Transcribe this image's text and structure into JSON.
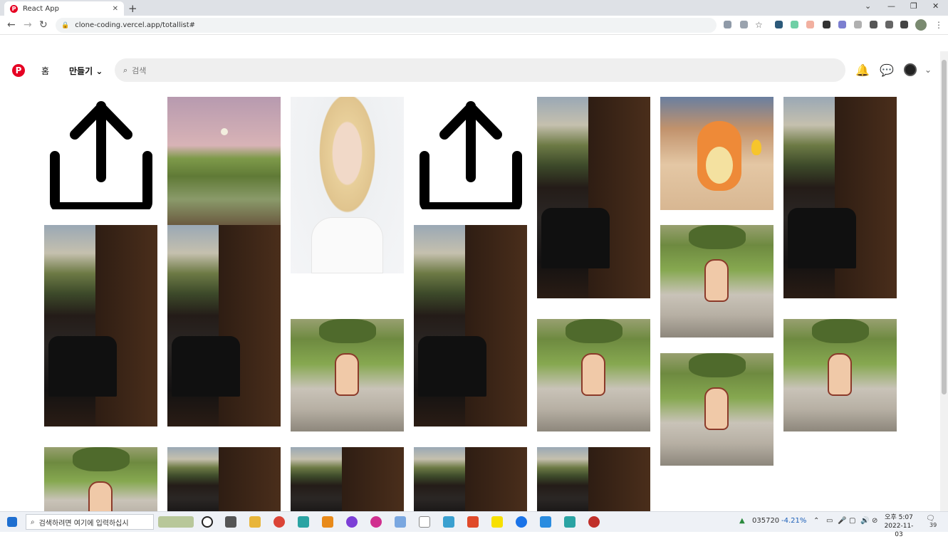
{
  "browser": {
    "tab_title": "React App",
    "tab_close": "✕",
    "new_tab": "+",
    "url": "clone-coding.vercel.app/totallist#"
  },
  "header": {
    "logo": "P",
    "home": "홈",
    "create": "만들기",
    "create_chevron": "⌄",
    "search_placeholder": "검색"
  },
  "pins": [
    {
      "type": "upload"
    },
    {
      "type": "meadow"
    },
    {
      "type": "girl"
    },
    {
      "type": "upload"
    },
    {
      "type": "room"
    },
    {
      "type": "charmander"
    },
    {
      "type": "room"
    },
    {
      "type": "room"
    },
    {
      "type": "room"
    },
    {
      "type": "shinchan"
    },
    {
      "type": "room"
    },
    {
      "type": "shinchan"
    },
    {
      "type": "shinchan"
    },
    {
      "type": "shinchan"
    },
    {
      "type": "shinchan"
    },
    {
      "type": "shinchan"
    },
    {
      "type": "room"
    },
    {
      "type": "room"
    },
    {
      "type": "room"
    },
    {
      "type": "room"
    }
  ],
  "taskbar": {
    "search_placeholder": "검색하려면 여기에 입력하십시",
    "stock_code": "035720",
    "stock_change": "-4.21%",
    "time_ampm": "오후 5:07",
    "date": "2022-11-03",
    "notif_count": "39"
  }
}
